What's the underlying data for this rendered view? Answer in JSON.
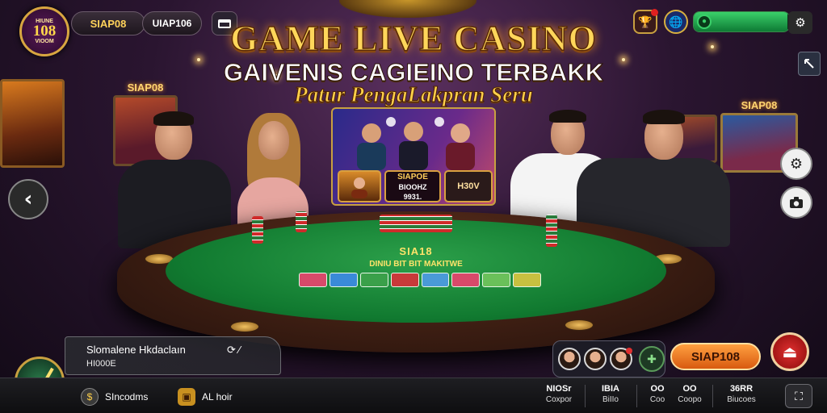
{
  "header": {
    "logo": {
      "top": "HIUNE",
      "main": "108",
      "bottom": "VIOOM"
    },
    "pill_primary": "SIAP08",
    "pill_secondary": "UIAP106",
    "card_icon": "card-icon",
    "title_line1": "GAME LIVE CASINO",
    "title_line2": "GAIVENIS CAGIEINO TERBAKK",
    "title_line3": "Patur PengaLakpran Seru",
    "right_icons": [
      "trophy-icon",
      "globe-icon"
    ],
    "progress": {
      "fraction": 0.98,
      "color": "#3ad06a",
      "icon": "chip-icon"
    },
    "settings_icon": "gear-icon",
    "expand_icon": "expand-icon"
  },
  "scene": {
    "sign_left": "SIAP08",
    "sign_right": "SIAP08",
    "table_title": "SIA18",
    "table_subtitle": "DINIU BIT BIT MAKITWE"
  },
  "video_panel": {
    "card_left_icon": "player-icon",
    "card_mid": {
      "line1": "SIAPOE",
      "line2": "BIOOHZ",
      "line3": "9931."
    },
    "card_right": "H30V"
  },
  "controls": {
    "back_icon": "chevron-left-icon",
    "side_top_icon": "gear-icon",
    "side_bottom_icon": "camera-icon"
  },
  "info_panel": {
    "title": "Slomalene Hkdaclaın",
    "subtitle": "HI000E",
    "icon": "refresh-icon"
  },
  "bottom": {
    "compass_icon": "compass-icon",
    "item1_label": "SIncodms",
    "item1_icon": "coin-icon",
    "item2_label": "AL hoir",
    "item2_icon": "gift-icon",
    "stats": [
      {
        "label": "NIOSr",
        "value": "Coxpor"
      },
      {
        "label": "IBIA",
        "value": "BiIIo"
      },
      {
        "label": "OO",
        "value": "Coo"
      },
      {
        "label": "OO",
        "value": "Coopo"
      },
      {
        "label": "36RR",
        "value": "Biucoes"
      }
    ],
    "player_add_icon": "add-player-icon",
    "pill_cta": "SIAP108",
    "red_button_icon": "exit-icon",
    "corner_icon": "fullscreen-icon"
  },
  "colors": {
    "gold": "#ffd65a",
    "felt_green": "#1e8a3c",
    "accent_orange": "#ff8a30",
    "danger_red": "#d02020"
  }
}
